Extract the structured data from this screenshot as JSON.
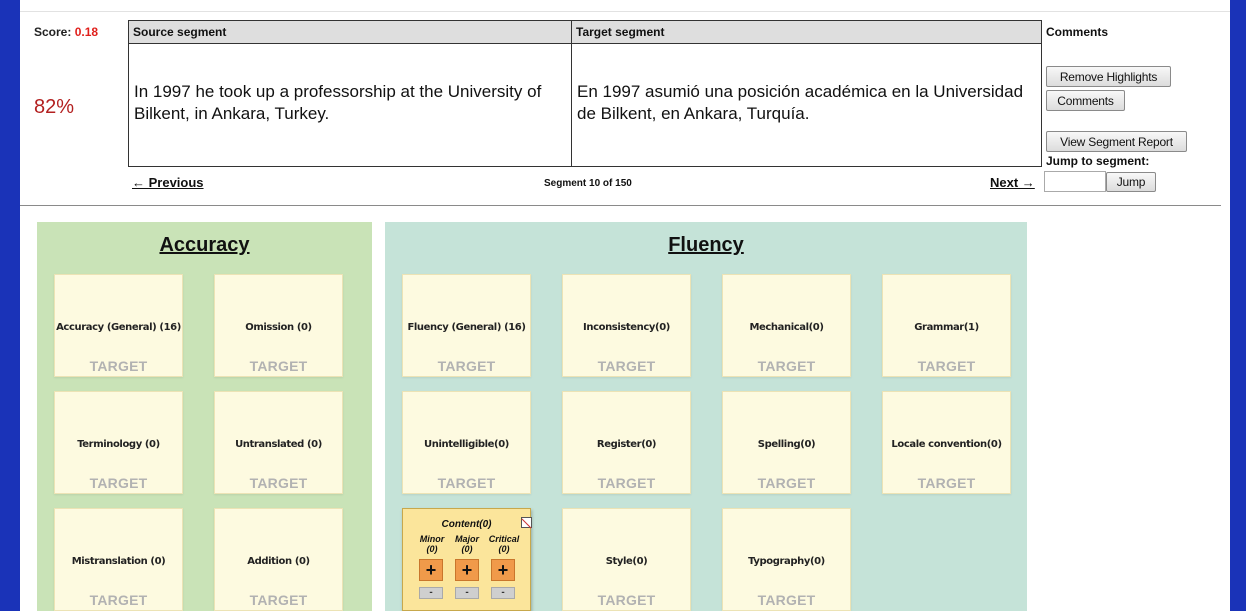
{
  "score": {
    "label": "Score:",
    "value": "0.18",
    "percent": "82%"
  },
  "segment": {
    "source_header": "Source segment",
    "target_header": "Target segment",
    "source_text": "In 1997 he took up a professorship at the University of Bilkent, in Ankara, Turkey.",
    "target_text": "En 1997 asumió una posición académica en la Universidad de Bilkent, en Ankara, Turquía."
  },
  "nav": {
    "previous": "← Previous",
    "next": "Next →",
    "counter": "Segment 10 of 150"
  },
  "sidebar": {
    "comments_header": "Comments",
    "remove_highlights": "Remove Highlights",
    "comments_button": "Comments",
    "view_report": "View Segment Report",
    "jump_label": "Jump to segment:",
    "jump_value": "",
    "jump_button": "Jump"
  },
  "accuracy": {
    "title": "Accuracy",
    "cards": [
      {
        "label": "Accuracy (General) (16)",
        "target": "TARGET"
      },
      {
        "label": "Omission (0)",
        "target": "TARGET"
      },
      {
        "label": "Terminology (0)",
        "target": "TARGET"
      },
      {
        "label": "Untranslated (0)",
        "target": "TARGET"
      },
      {
        "label": "Mistranslation (0)",
        "target": "TARGET"
      },
      {
        "label": "Addition (0)",
        "target": "TARGET"
      }
    ]
  },
  "fluency": {
    "title": "Fluency",
    "cards": [
      {
        "label": "Fluency (General) (16)",
        "target": "TARGET"
      },
      {
        "label": "Inconsistency(0)",
        "target": "TARGET"
      },
      {
        "label": "Mechanical(0)",
        "target": "TARGET"
      },
      {
        "label": "Grammar(1)",
        "target": "TARGET"
      },
      {
        "label": "Unintelligible(0)",
        "target": "TARGET"
      },
      {
        "label": "Register(0)",
        "target": "TARGET"
      },
      {
        "label": "Spelling(0)",
        "target": "TARGET"
      },
      {
        "label": "Locale convention(0)",
        "target": "TARGET"
      },
      {
        "label": "Style(0)",
        "target": "TARGET"
      },
      {
        "label": "Typography(0)",
        "target": "TARGET"
      }
    ],
    "active": {
      "title": "Content(0)",
      "severities": [
        {
          "name": "Minor",
          "count": "(0)",
          "plus": "+",
          "minus": "-"
        },
        {
          "name": "Major",
          "count": "(0)",
          "plus": "+",
          "minus": "-"
        },
        {
          "name": "Critical",
          "count": "(0)",
          "plus": "+",
          "minus": "-"
        }
      ]
    }
  },
  "colors": {
    "frame": "#1a33b8",
    "accuracy_panel": "#c9e3b7",
    "fluency_panel": "#c5e3d8",
    "card": "#fdfae0",
    "active_card": "#fbe59b",
    "plus_button": "#f09a4a",
    "score_value": "#e0201c"
  }
}
